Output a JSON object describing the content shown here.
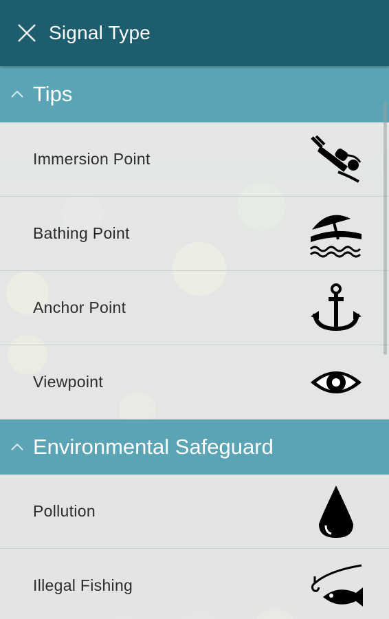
{
  "appbar": {
    "title": "Signal Type",
    "close_icon": "close-icon"
  },
  "sections": [
    {
      "title": "Tips",
      "expanded": true,
      "items": [
        {
          "label": "Immersion Point",
          "icon": "scuba-diver-icon"
        },
        {
          "label": "Bathing Point",
          "icon": "beach-umbrella-icon"
        },
        {
          "label": "Anchor Point",
          "icon": "anchor-icon"
        },
        {
          "label": "Viewpoint",
          "icon": "eye-icon"
        }
      ]
    },
    {
      "title": "Environmental Safeguard",
      "expanded": true,
      "items": [
        {
          "label": "Pollution",
          "icon": "oil-drop-icon"
        },
        {
          "label": "Illegal Fishing",
          "icon": "fish-hook-icon"
        }
      ]
    }
  ],
  "colors": {
    "appbar": "#1d5d6d",
    "section_header": "#5aa4b5",
    "row_background": "#f7f8f8",
    "text": "#2b2b2b"
  }
}
